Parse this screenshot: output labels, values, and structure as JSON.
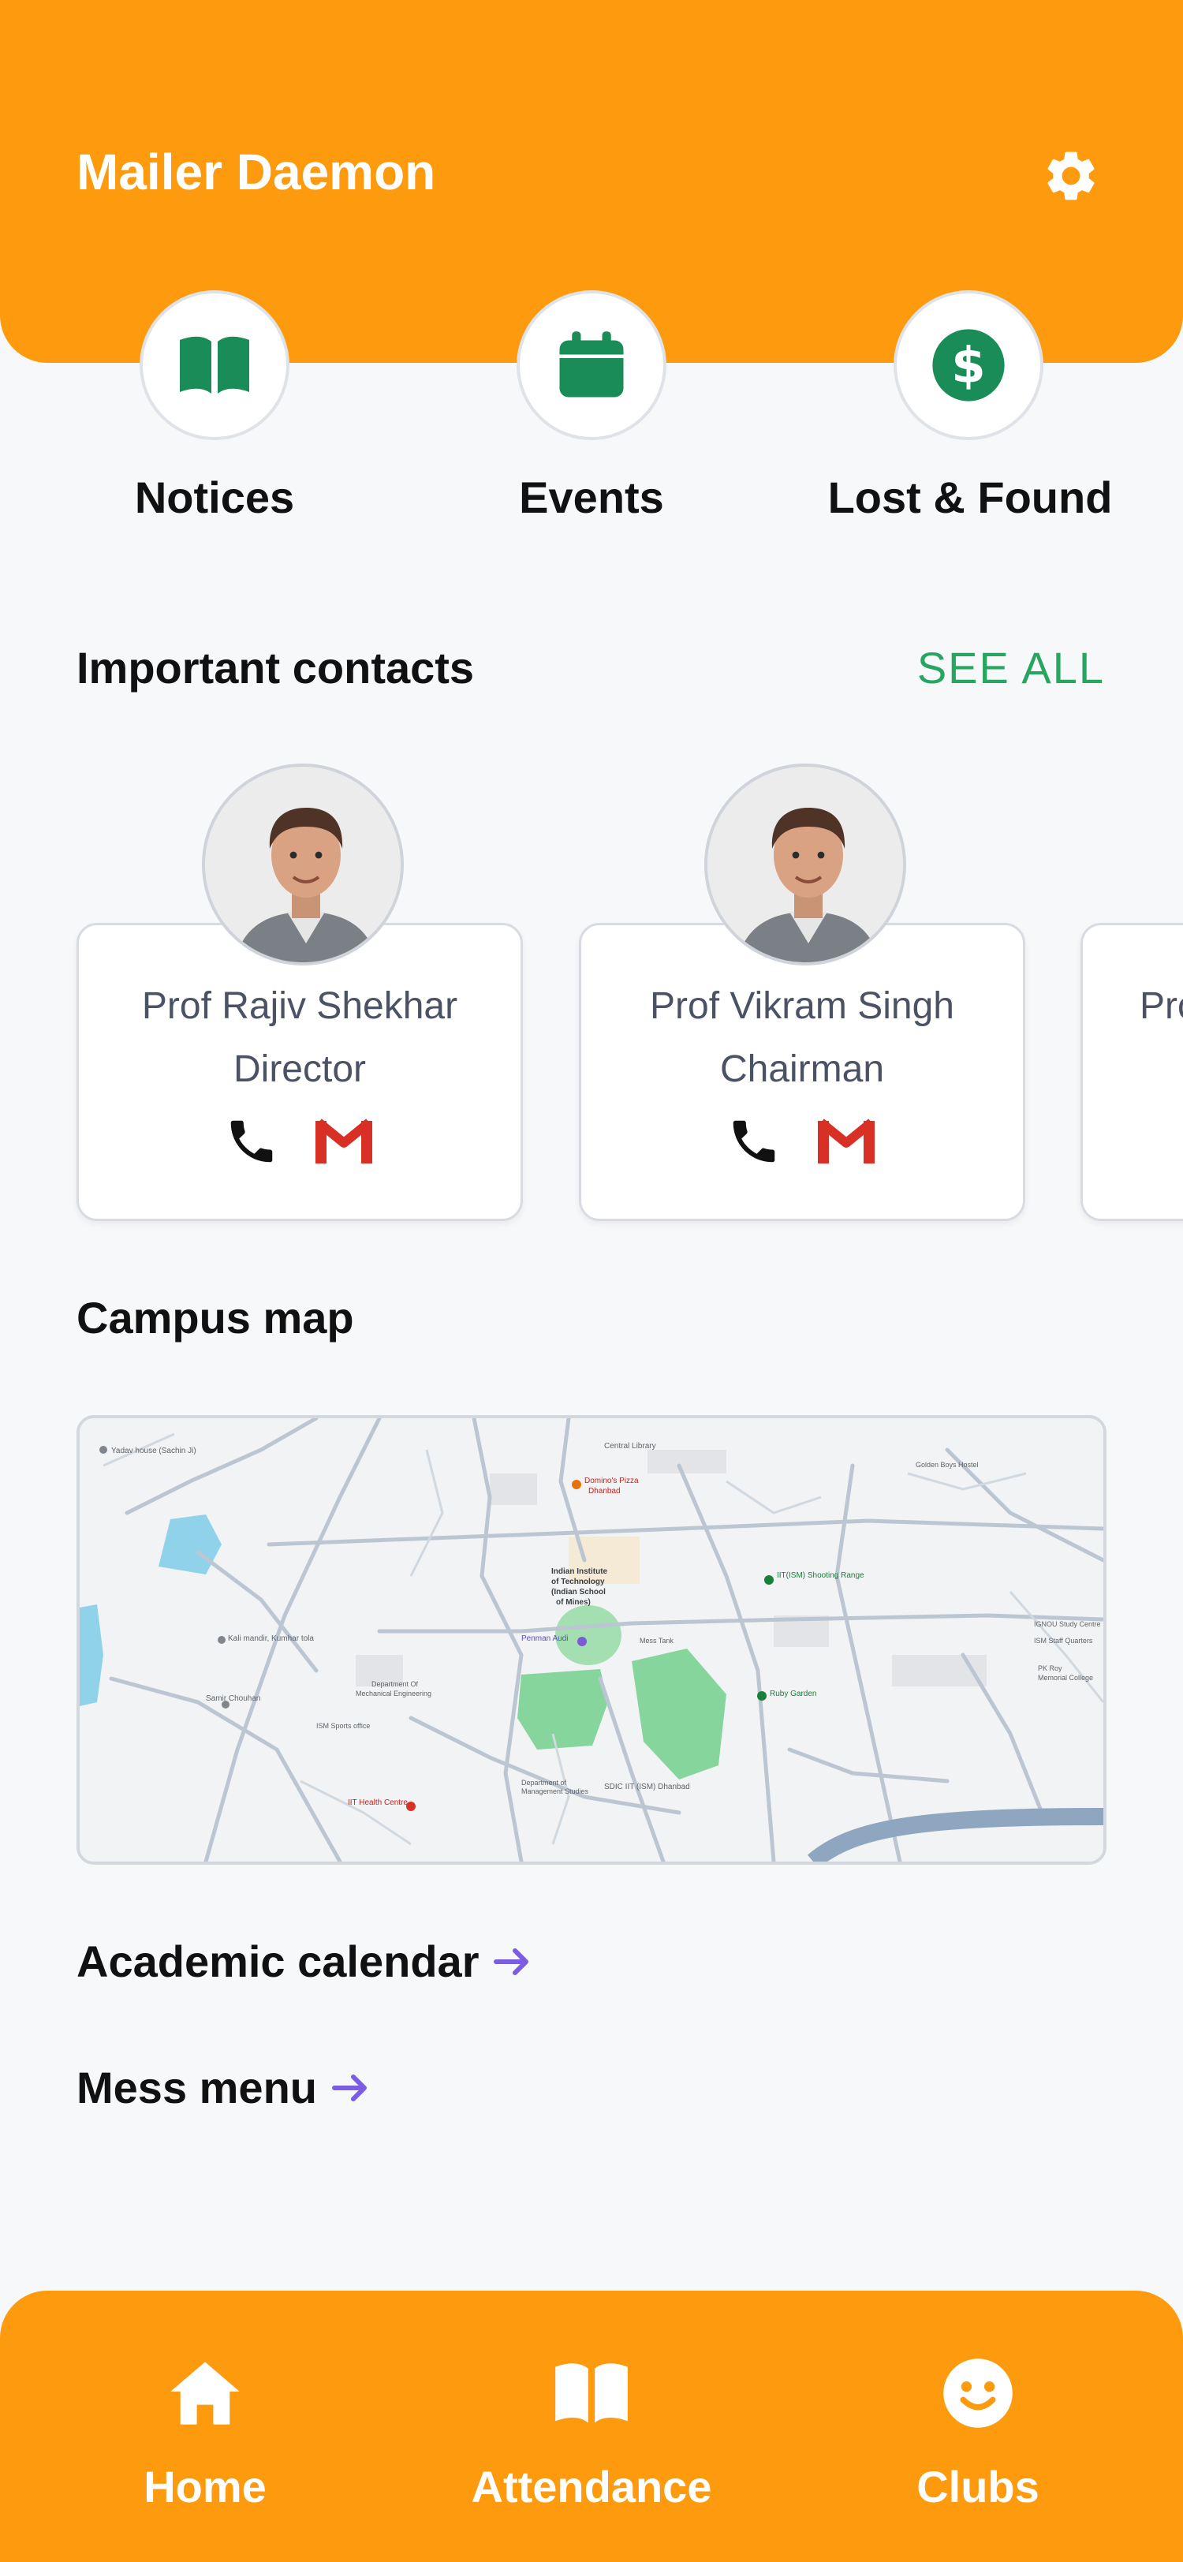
{
  "header": {
    "title": "Mailer Daemon",
    "settings_icon": "gear-icon",
    "background_color": "#fd9a0d"
  },
  "quick_actions": [
    {
      "label": "Notices",
      "icon": "open-book-icon"
    },
    {
      "label": "Events",
      "icon": "calendar-icon"
    },
    {
      "label": "Lost & Found",
      "icon": "dollar-icon"
    }
  ],
  "contacts": {
    "title": "Important contacts",
    "see_all": "SEE ALL",
    "items": [
      {
        "name": "Prof Rajiv Shekhar",
        "role": "Director"
      },
      {
        "name": "Prof Vikram Singh",
        "role": "Chairman"
      },
      {
        "name": "Prof",
        "role": ""
      }
    ]
  },
  "campus_map": {
    "title": "Campus map",
    "labels": [
      "Yadav house (Sachin Ji)",
      "Central Library",
      "Domino's Pizza Dhanbad",
      "Indian Institute of Technology (Indian School of Mines)",
      "IIT(ISM) Shooting Range",
      "Penman Auditorium",
      "Kali mandir, Kumhar tola",
      "Samir Chouhan",
      "Ruby Garden",
      "IIT Health Centre",
      "SDIC IIT (ISM) Dhanbad",
      "Department Of Mechanical Engineering",
      "Mess Tank",
      "ISM Sports office",
      "IGNOU Study Centre",
      "ISM Staff Quarters",
      "PK Roy Memorial College",
      "Golden Boys Hostel",
      "Department of Management Studies"
    ]
  },
  "links": [
    {
      "label": "Academic calendar"
    },
    {
      "label": "Mess menu"
    }
  ],
  "bottom_nav": [
    {
      "label": "Home",
      "icon": "home-icon"
    },
    {
      "label": "Attendance",
      "icon": "book-icon"
    },
    {
      "label": "Clubs",
      "icon": "smiley-icon"
    }
  ],
  "colors": {
    "accent": "#fd9a0d",
    "green": "#1a8c57",
    "see_all": "#27a661",
    "arrow": "#7c5ce4",
    "gmail_red": "#d93025"
  }
}
